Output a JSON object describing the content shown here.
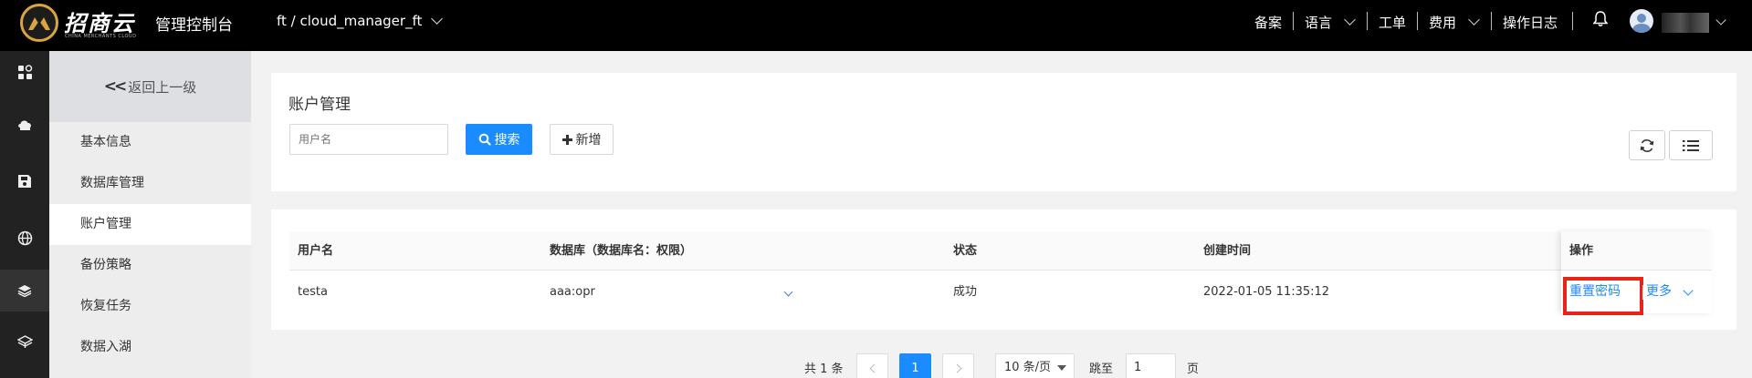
{
  "header": {
    "brand_cn": "招商云",
    "brand_en": "CHINA MERCHANTS CLOUD",
    "console_title": "管理控制台",
    "project": "ft / cloud_manager_ft",
    "nav": {
      "record": "备案",
      "language": "语言",
      "ticket": "工单",
      "cost": "费用",
      "op_log": "操作日志"
    }
  },
  "rail": {
    "icons": [
      "dashboard-icon",
      "cloud-host-icon",
      "storage-icon",
      "network-icon",
      "database-icon",
      "layers-icon"
    ]
  },
  "sidebar": {
    "back_label": "返回上一级",
    "items": [
      {
        "label": "基本信息"
      },
      {
        "label": "数据库管理"
      },
      {
        "label": "账户管理",
        "active": true
      },
      {
        "label": "备份策略"
      },
      {
        "label": "恢复任务"
      },
      {
        "label": "数据入湖"
      }
    ]
  },
  "main": {
    "title": "账户管理",
    "search": {
      "placeholder": "用户名",
      "value": ""
    },
    "search_button": "搜索",
    "add_button": "新增"
  },
  "table": {
    "columns": [
      "用户名",
      "数据库（数据库名：权限）",
      "状态",
      "创建时间",
      "操作"
    ],
    "rows": [
      {
        "username": "testa",
        "database": "aaa:opr",
        "status": "成功",
        "created": "2022-01-05 11:35:12",
        "actions": {
          "reset": "重置密码",
          "more": "更多"
        }
      }
    ]
  },
  "pagination": {
    "total_text": "共 1 条",
    "current_page": "1",
    "page_size": "10 条/页",
    "jump_label": "跳至",
    "jump_value": "1",
    "page_suffix": "页"
  },
  "colors": {
    "primary": "#1a8cff",
    "highlight_box": "#e8231a",
    "header_bg": "#000000",
    "rail_bg": "#222222",
    "logo_ring": "#d9a441"
  }
}
